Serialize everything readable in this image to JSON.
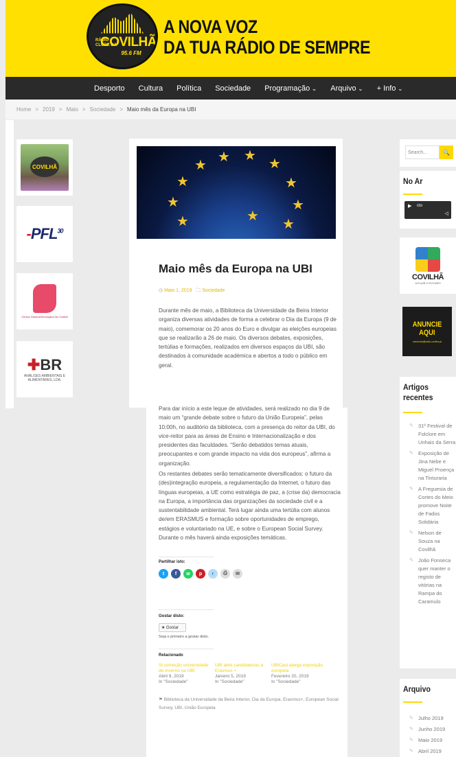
{
  "header": {
    "logo": {
      "radio": "RÁDIO",
      "clube": "CLUBE DA",
      "name": "COVILHÃ",
      "freq": "95.6 FM"
    },
    "tagline_line1": "A NOVA VOZ",
    "tagline_line2": "DA TUA RÁDIO DE SEMPRE"
  },
  "nav": {
    "items": [
      {
        "label": "Desporto"
      },
      {
        "label": "Cultura"
      },
      {
        "label": "Política"
      },
      {
        "label": "Sociedade"
      },
      {
        "label": "Programação"
      },
      {
        "label": "Arquivo"
      },
      {
        "label": "+ Info"
      }
    ]
  },
  "breadcrumb": [
    "Home",
    "2019",
    "Maio",
    "Sociedade",
    "Maio mês da Europa na UBI"
  ],
  "left_ads": {
    "ad1": "COVILHÃ",
    "ad2": {
      "text": "PFL",
      "sup": "30"
    },
    "ad3": "Clínica Gastroenterológica da Covilhã",
    "ad4": {
      "big": "BR",
      "small": "ANÁLISES AMBIENTAIS E ALIMENTARES, LDA."
    }
  },
  "article": {
    "title": "Maio mês da Europa na UBI",
    "date": "Maio 1, 2019",
    "category": "Sociedade",
    "p1": "Durante mês de maio, a Biblioteca da Universidade da Beira Interior organiza diversas atividades de forma a celebrar o Dia da Europa (9 de maio), comemorar os 20 anos do Euro e divulgar as eleições europeias que se realizarão a 26 de maio. Os diversos debates, exposições, tertúlias e formações, realizados em diversos espaços da UBI, são destinados à comunidade académica e abertos a todo o público em geral.",
    "p2": "Para dar início a este leque de atividades, será realizado no dia 9 de maio um “grande debate sobre o futuro da União Europeia”, pelas 10:00h, no auditório da biblioteca, com a presença do reitor da UBI, do vice-reitor para as áreas de Ensino e Internacionalização e dos presidentes das faculdades. “Serão debatidos temas atuais, preocupantes e com grande impacto na vida dos europeus”, afirma a organização.",
    "p3": "Os restantes debates serão tematicamente diversificados: o futuro da (des)integração europeia, a regulamentação da Internet, o futuro das línguas europeias, a UE como estratégia de paz, a (crise da) democracia na Europa, a importância das organizações da sociedade civil e a sustentabilidade ambiental. Terá lugar ainda uma tertúlia com alunos de/em ERASMUS e formação sobre oportunidades de emprego, estágios e voluntariado na UE, e sobre o European Social Survey. Durante o mês haverá ainda exposições temáticas.",
    "share_label": "Partilhar isto:",
    "like_label": "Gostar disto:",
    "like_button": "★ Gostar",
    "first_like": "Seja o primeiro a gostar disto.",
    "related_label": "Relacionado",
    "related": [
      {
        "title": "Si começão universidade de Inverno na UBI",
        "date": "Abril 9, 2019",
        "cat": "In \"Sociedade\""
      },
      {
        "title": "UBI abre candidaturas a Erasmus +",
        "date": "Janeiro 5, 2019",
        "cat": "In \"Sociedade\""
      },
      {
        "title": "UBICast alarga exposição europeia",
        "date": "Fevereiro 20, 2019",
        "cat": "In \"Sociedade\""
      }
    ],
    "tags": "Biblioteca da Universidade da Beira Interior, Dia da Europa, Erasmus+, European Social Survey, UBI, União Europeia"
  },
  "sidebar": {
    "search_placeholder": "Search...",
    "search_icon": "search-icon",
    "no_ar_title": "No Ar",
    "player_text": "cto",
    "covilha_name": "COVILHÃ",
    "covilha_sub": "A FLUIR O FUTURO",
    "anuncie_line1": "ANUNCIE",
    "anuncie_line2": "AQUI",
    "anuncie_email": "comercial@radio-covilha.pt",
    "artigos_title1": "Artigos",
    "artigos_title2": "recentes",
    "recent_posts": [
      "31º Festival de Folclore em Unhais da Serra",
      "Exposição de Jina Nebe e Miguel Proença na Tinturaria",
      "A Freguesia de Cortes do Meio promove Noite de Fados Solidária",
      "Nelson de Souza na Covilhã",
      "João Fonseca quer manter o registo de vitórias na Rampa do Caramulo"
    ],
    "arquivo_title": "Arquivo",
    "archive": [
      "Julho 2019",
      "Junho 2019",
      "Maio 2019",
      "Abril 2019"
    ]
  },
  "colors": {
    "brand_yellow": "#ffe000",
    "nav_dark": "#2a2a2a",
    "accent": "#ffd800"
  }
}
